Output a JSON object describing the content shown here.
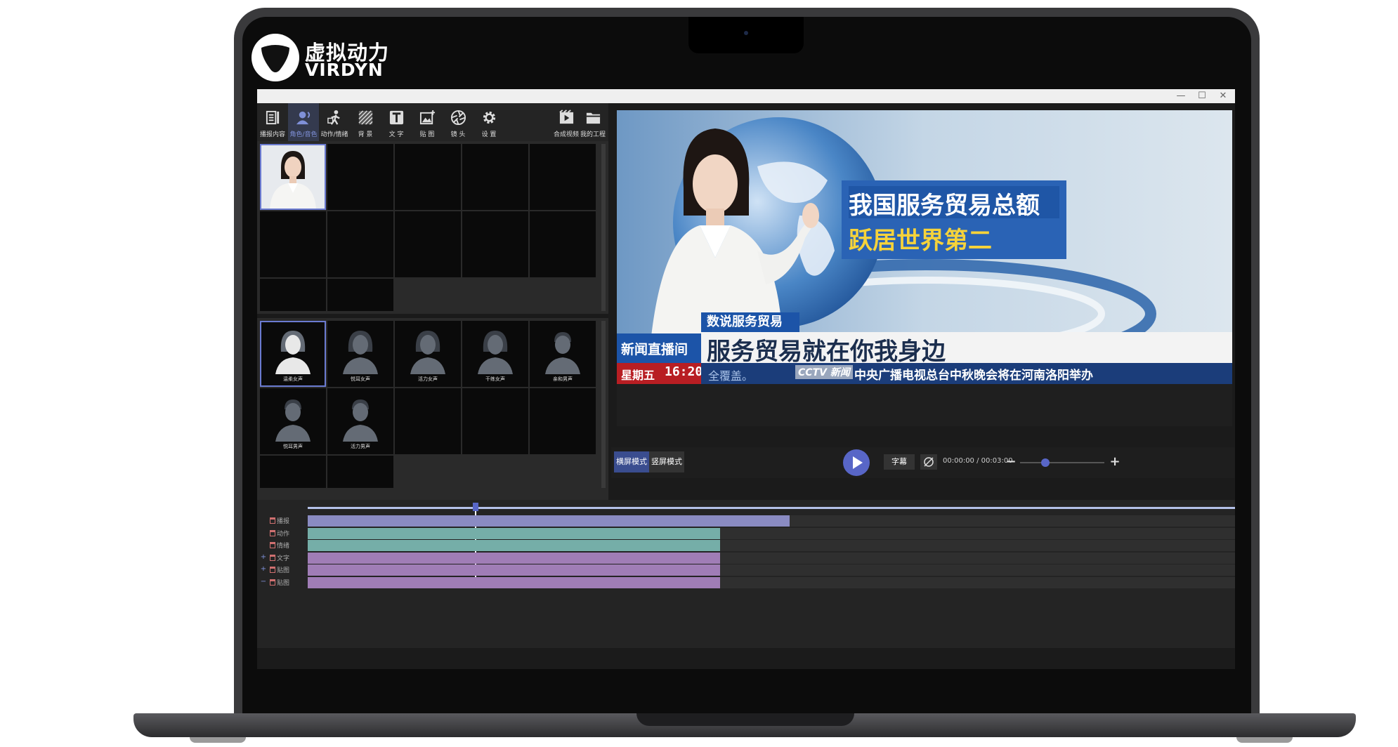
{
  "brand": {
    "name_cn": "虚拟动力",
    "name_en": "VIRDYN"
  },
  "window": {
    "controls": [
      "—",
      "☐",
      "✕"
    ]
  },
  "toolbar": {
    "left": [
      {
        "label": "播报内容",
        "icon": "document-list-icon"
      },
      {
        "label": "角色/音色",
        "icon": "user-voice-icon",
        "active": true
      },
      {
        "label": "动作/情绪",
        "icon": "motion-emotion-icon"
      },
      {
        "label": "背  景",
        "icon": "background-texture-icon"
      },
      {
        "label": "文  字",
        "icon": "text-icon"
      },
      {
        "label": "贴  图",
        "icon": "sticker-image-icon"
      },
      {
        "label": "镜  头",
        "icon": "camera-lens-icon"
      },
      {
        "label": "设  置",
        "icon": "gear-icon"
      }
    ],
    "right": [
      {
        "label": "合成视频",
        "icon": "render-video-icon"
      },
      {
        "label": "我的工程",
        "icon": "folder-icon"
      }
    ]
  },
  "voices": [
    "温柔女声",
    "悦耳女声",
    "活力女声",
    "干练女声",
    "亲和男声",
    "悦耳男声",
    "活力男声"
  ],
  "preview": {
    "headline_line1": "我国服务贸易总额",
    "headline_line2": "跃居世界第二",
    "tag": "数说服务贸易",
    "subtitle": "服务贸易就在你我身边",
    "program": "新闻直播间",
    "weekday": "星期五",
    "clock": "16:20",
    "ticker_left": "全覆盖。",
    "station": "CCTV 新闻",
    "ticker": "中央广播电视总台中秋晚会将在河南洛阳举办"
  },
  "controls": {
    "landscape_label": "横屏模式",
    "portrait_label": "竖屏模式",
    "subtitle_label": "字幕",
    "time_current": "00:00:00",
    "time_total": "00:03:00",
    "time_sep": "/",
    "zoom_level": 0.3
  },
  "timeline": {
    "playhead_fraction": 0.18,
    "tracks": [
      {
        "label": "播报",
        "color": "#8a8bc2",
        "end_fraction": 0.52,
        "expand": ""
      },
      {
        "label": "动作",
        "color": "#75aea8",
        "end_fraction": 0.445,
        "expand": ""
      },
      {
        "label": "情绪",
        "color": "#75aea8",
        "end_fraction": 0.445,
        "expand": ""
      },
      {
        "label": "文字",
        "color": "#a07db6",
        "end_fraction": 0.445,
        "expand": "+"
      },
      {
        "label": "贴图",
        "color": "#a07db6",
        "end_fraction": 0.445,
        "expand": "+"
      },
      {
        "label": "贴图",
        "color": "#a07db6",
        "end_fraction": 0.445,
        "expand": "−"
      }
    ]
  }
}
